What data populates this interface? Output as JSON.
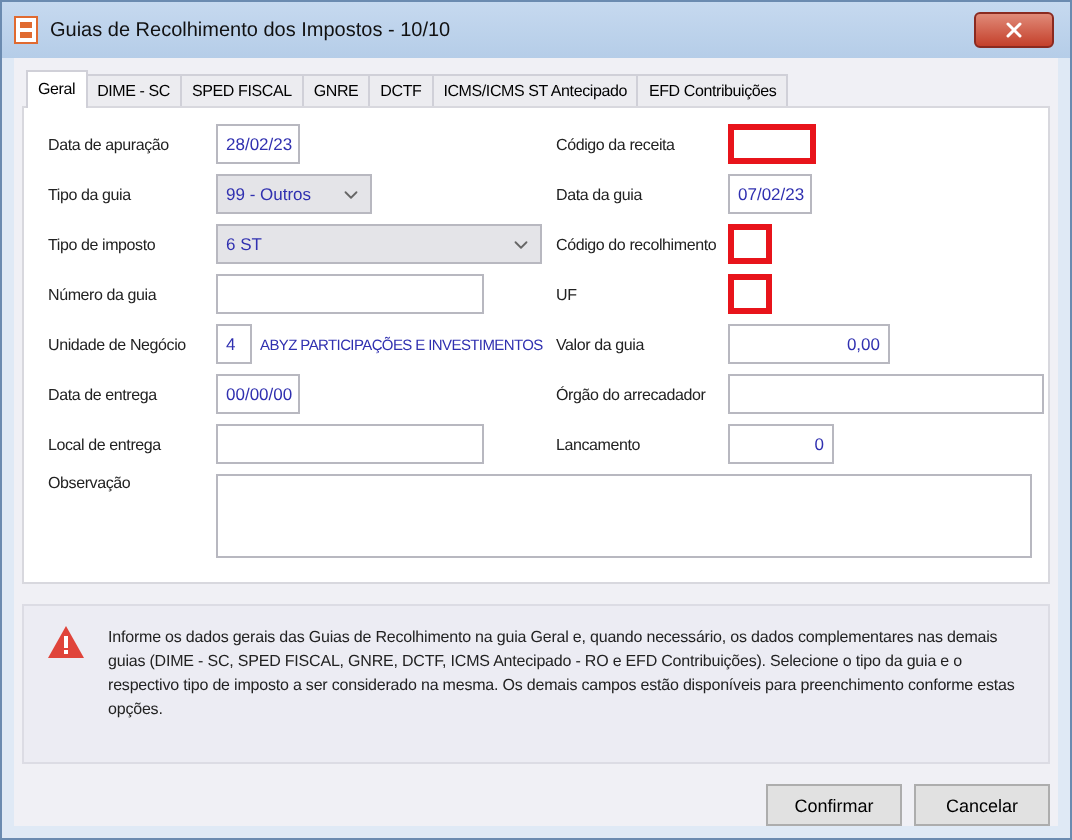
{
  "window": {
    "title": "Guias de Recolhimento dos Impostos - 10/10"
  },
  "tabs": [
    {
      "label": "Geral",
      "selected": true
    },
    {
      "label": "DIME - SC",
      "selected": false
    },
    {
      "label": "SPED FISCAL",
      "selected": false
    },
    {
      "label": "GNRE",
      "selected": false
    },
    {
      "label": "DCTF",
      "selected": false
    },
    {
      "label": "ICMS/ICMS ST Antecipado",
      "selected": false
    },
    {
      "label": "EFD Contribuições",
      "selected": false
    }
  ],
  "left_fields": [
    {
      "label": "Data de apuração",
      "kind": "date",
      "value": "28/02/23",
      "highlighted": false
    },
    {
      "label": "Tipo da guia",
      "kind": "select-short",
      "value": "99 - Outros",
      "highlighted": false
    },
    {
      "label": "Tipo de imposto",
      "kind": "select-long",
      "value": "6 ST",
      "highlighted": false
    },
    {
      "label": "Número da guia",
      "kind": "text",
      "highlighted": false
    },
    {
      "label": "Unidade de Negócio",
      "kind": "unit",
      "value": "4",
      "name": "ABYZ PARTICIPAÇÕES E INVESTIMENTOS",
      "highlighted": false
    },
    {
      "label": "Data de entrega",
      "kind": "date",
      "value": "00/00/00",
      "highlighted": false
    },
    {
      "label": "Local de entrega",
      "kind": "text",
      "highlighted": false
    }
  ],
  "right_fields": [
    {
      "label": "Código da receita",
      "kind": "short-text",
      "highlighted": true
    },
    {
      "label": "Data da guia",
      "kind": "date",
      "value": "07/02/23",
      "highlighted": false
    },
    {
      "label": "Código do recolhimento",
      "kind": "tiny-text",
      "highlighted": true
    },
    {
      "label": "UF",
      "kind": "tiny-text",
      "highlighted": true
    },
    {
      "label": "Valor da guia",
      "kind": "money",
      "value": "0,00",
      "highlighted": false
    },
    {
      "label": "Órgão do arrecadador",
      "kind": "long-text",
      "highlighted": false
    },
    {
      "label": "Lancamento",
      "kind": "number",
      "value": "0",
      "highlighted": false
    }
  ],
  "observation": {
    "label": "Observação"
  },
  "info": {
    "text": "Informe os dados gerais das Guias de Recolhimento na guia Geral e, quando necessário, os dados complementares nas demais guias (DIME - SC, SPED FISCAL, GNRE, DCTF, ICMS Antecipado - RO e EFD Contribuições). Selecione o tipo da guia e o respectivo tipo de imposto a ser considerado na mesma. Os demais campos estão disponíveis para preenchimento conforme estas opções."
  },
  "buttons": [
    {
      "label": "Confirmar"
    },
    {
      "label": "Cancelar"
    }
  ]
}
